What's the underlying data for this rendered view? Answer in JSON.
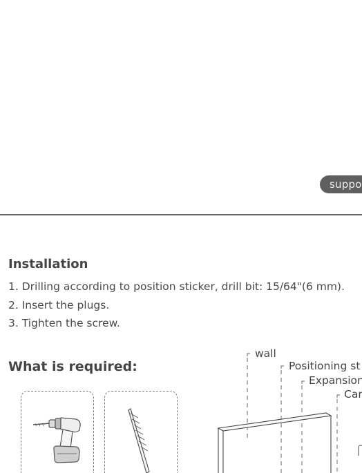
{
  "support_button": {
    "label": "suppo"
  },
  "installation": {
    "heading": "Installation",
    "steps": [
      "1. Drilling according to position sticker, drill bit: 15/64\"(6 mm).",
      "2. Insert the plugs.",
      "3. Tighten the screw."
    ]
  },
  "requirements": {
    "heading": "What is required:",
    "tools": [
      "drill-icon",
      "drill-bit-icon"
    ]
  },
  "diagram": {
    "labels": {
      "wall": "wall",
      "positioning": "Positioning st",
      "expansion": "Expansion",
      "car": "Car"
    }
  }
}
